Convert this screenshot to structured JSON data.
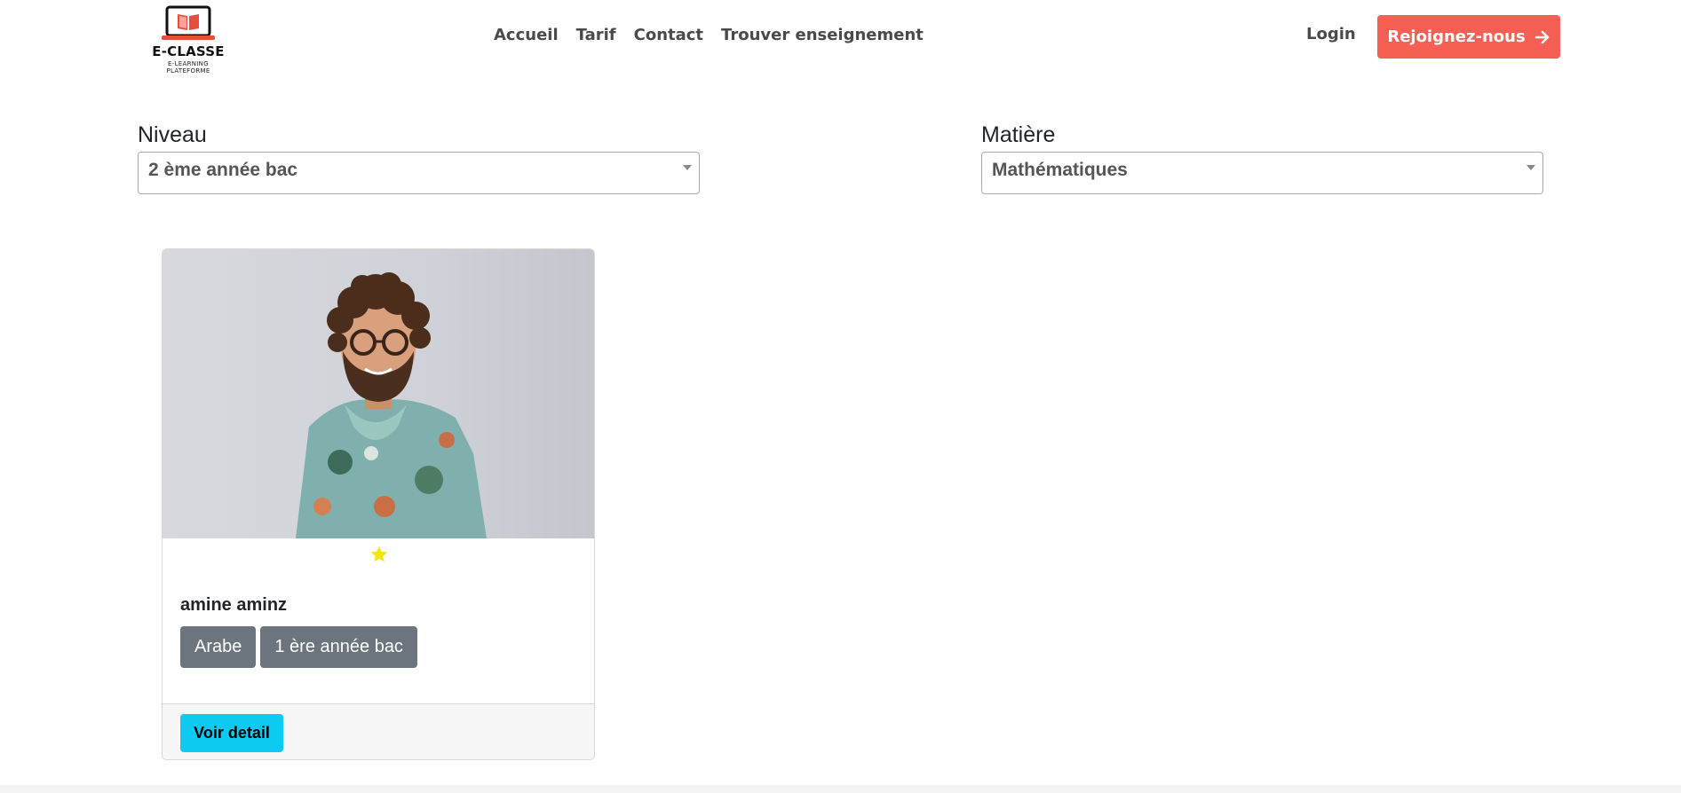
{
  "header": {
    "logo": {
      "title": "E-CLASSE",
      "subtitle": "E-LEARNING PLATEFORME",
      "icon": "laptop-book-icon",
      "accent": "#e74c3c"
    },
    "nav": [
      "Accueil",
      "Tarif",
      "Contact",
      "Trouver enseignement"
    ],
    "login_label": "Login",
    "join_label": "Rejoignez-nous",
    "join_icon": "arrow-right-icon",
    "join_color": "#f65f53"
  },
  "filters": {
    "niveau": {
      "label": "Niveau",
      "value": "2 ème année bac"
    },
    "matiere": {
      "label": "Matière",
      "value": "Mathématiques"
    }
  },
  "teachers": [
    {
      "name": "amine aminz",
      "rating_icon": "star-icon",
      "star_color": "#f5e60a",
      "badges": [
        "Arabe",
        "1 ère année bac"
      ],
      "detail_label": "Voir detail",
      "detail_color": "#0dcaf0"
    }
  ]
}
